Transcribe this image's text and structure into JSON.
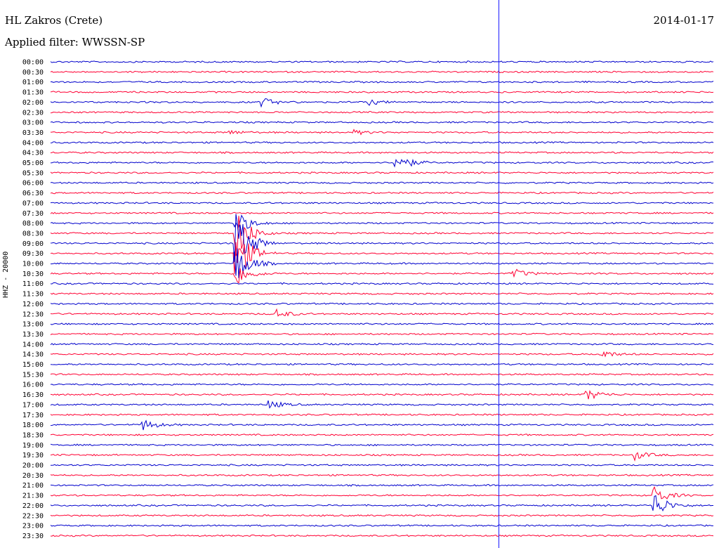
{
  "header": {
    "station": "HL Zakros (Crete)",
    "date": "2014-01-17",
    "filter": "Applied filter: WWSSN-SP"
  },
  "chart_data": {
    "type": "line",
    "title": "HL Zakros (Crete)",
    "subtitle": "Applied filter: WWSSN-SP",
    "date": "2014-01-17",
    "ylabel": "HHZ - 20000",
    "rows": [
      "00:00",
      "00:30",
      "01:00",
      "01:30",
      "02:00",
      "02:30",
      "03:00",
      "03:30",
      "04:00",
      "04:30",
      "05:00",
      "05:30",
      "06:00",
      "06:30",
      "07:00",
      "07:30",
      "08:00",
      "08:30",
      "09:00",
      "09:30",
      "10:00",
      "10:30",
      "11:00",
      "11:30",
      "12:00",
      "12:30",
      "13:00",
      "13:30",
      "14:00",
      "14:30",
      "15:00",
      "15:30",
      "16:00",
      "16:30",
      "17:00",
      "17:30",
      "18:00",
      "18:30",
      "19:00",
      "19:30",
      "20:00",
      "20:30",
      "21:00",
      "21:30",
      "22:00",
      "22:30",
      "23:00",
      "23:30"
    ],
    "colors": [
      "#0000cc",
      "#ff0033"
    ],
    "events": [
      {
        "row": 4,
        "pos": 0.32,
        "amp": 6
      },
      {
        "row": 4,
        "pos": 0.48,
        "amp": 4
      },
      {
        "row": 7,
        "pos": 0.27,
        "amp": 3
      },
      {
        "row": 7,
        "pos": 0.46,
        "amp": 3
      },
      {
        "row": 10,
        "pos": 0.52,
        "amp": 16
      },
      {
        "row": 16,
        "pos": 0.28,
        "amp": 18
      },
      {
        "row": 17,
        "pos": 0.28,
        "amp": 40
      },
      {
        "row": 18,
        "pos": 0.28,
        "amp": 50
      },
      {
        "row": 19,
        "pos": 0.28,
        "amp": 45
      },
      {
        "row": 20,
        "pos": 0.28,
        "amp": 30
      },
      {
        "row": 21,
        "pos": 0.28,
        "amp": 18
      },
      {
        "row": 21,
        "pos": 0.7,
        "amp": 6
      },
      {
        "row": 25,
        "pos": 0.34,
        "amp": 7
      },
      {
        "row": 29,
        "pos": 0.83,
        "amp": 6
      },
      {
        "row": 33,
        "pos": 0.81,
        "amp": 8
      },
      {
        "row": 34,
        "pos": 0.33,
        "amp": 6
      },
      {
        "row": 36,
        "pos": 0.14,
        "amp": 8
      },
      {
        "row": 39,
        "pos": 0.88,
        "amp": 7
      },
      {
        "row": 43,
        "pos": 0.91,
        "amp": 14
      },
      {
        "row": 44,
        "pos": 0.91,
        "amp": 20
      }
    ]
  }
}
